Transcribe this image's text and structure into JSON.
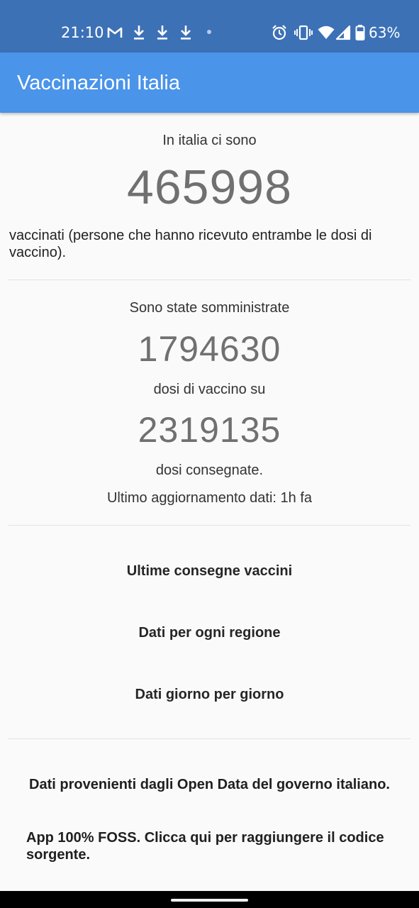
{
  "status_bar": {
    "time": "21:10",
    "battery_percent": "63%",
    "left_icons": [
      "gmail-icon",
      "download-icon",
      "download-icon",
      "download-icon",
      "notification-dot-icon"
    ],
    "right_icons": [
      "alarm-icon",
      "vibrate-icon",
      "wifi-icon",
      "cellular-signal-icon",
      "battery-icon"
    ],
    "background_color": "#3c71b6"
  },
  "app_bar": {
    "title": "Vaccinazioni Italia",
    "color": "#4a94e9"
  },
  "summary": {
    "vaccinated_intro": "In italia ci sono",
    "vaccinated_count": "465998",
    "vaccinated_desc": "vaccinati (persone che hanno ricevuto entrambe le dosi di vaccino).",
    "administered_intro": "Sono state somministrate",
    "administered_count": "1794630",
    "administered_mid": "dosi di vaccino su",
    "delivered_count": "2319135",
    "delivered_desc": "dosi consegnate.",
    "last_update": "Ultimo aggiornamento dati: 1h fa"
  },
  "actions": {
    "latest_deliveries": "Ultime consegne vaccini",
    "per_region": "Dati per ogni regione",
    "day_by_day": "Dati giorno per giorno"
  },
  "footer": {
    "source": "Dati provenienti dagli Open Data del governo italiano.",
    "foss": "App 100% FOSS. Clicca qui per raggiungere il codice sorgente."
  }
}
